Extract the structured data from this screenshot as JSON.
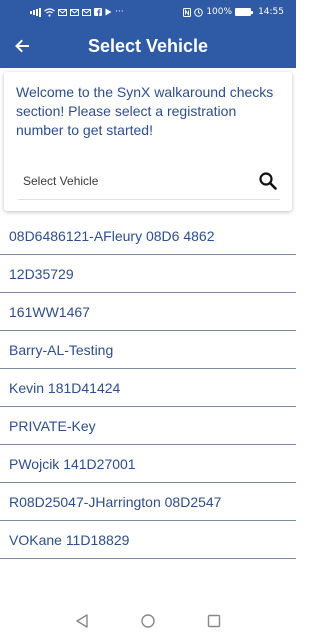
{
  "status_bar": {
    "left_icons": [
      "signal-icon",
      "wifi-icon",
      "mail-icon",
      "mail-icon",
      "mail-icon",
      "facebook-icon",
      "play-icon",
      "more-icon"
    ],
    "right_icons": [
      "nfc-icon",
      "alarm-icon"
    ],
    "battery_text": "100%",
    "battery_level": 1.0,
    "time": "14:55"
  },
  "header": {
    "title": "Select Vehicle",
    "back_icon": "arrow-left-icon",
    "background": "#2e5aa6"
  },
  "card": {
    "welcome_text": "Welcome to the SynX walkaround checks section! Please select a registration number to get started!",
    "search_placeholder": "Select Vehicle",
    "search_value": "",
    "search_icon": "search-icon"
  },
  "vehicles": [
    "08D6486121-AFleury 08D6 4862",
    "12D35729",
    "161WW1467",
    "Barry-AL-Testing",
    "Kevin 181D41424",
    "PRIVATE-Key",
    "PWojcik 141D27001",
    "R08D25047-JHarrington 08D2547",
    "VOKane 11D18829"
  ],
  "navigation_bar": {
    "buttons": [
      "back-triangle-icon",
      "home-circle-icon",
      "recents-square-icon"
    ]
  },
  "colors": {
    "primary": "#2e5aa6",
    "text_primary": "#2e4e8c",
    "divider": "#7a8aa3"
  }
}
